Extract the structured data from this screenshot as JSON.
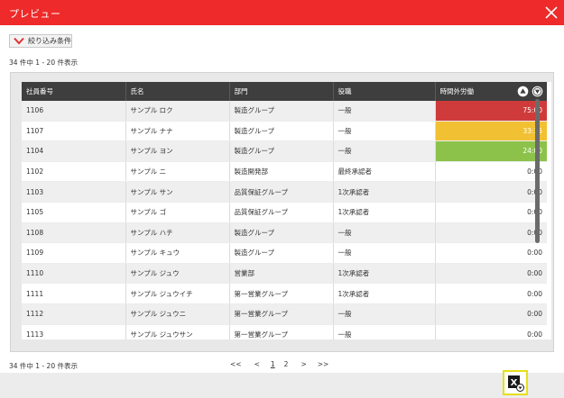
{
  "title": "プレビュー",
  "filter_button": {
    "label": "絞り込み条件"
  },
  "result_count": "34 件中 1 - 20 件表示",
  "result_count_bottom": "34 件中 1 - 20 件表示",
  "columns": [
    "社員番号",
    "氏名",
    "部門",
    "役職",
    "時間外労働"
  ],
  "rows": [
    {
      "id": "1106",
      "name": "サンプル ロク",
      "dept": "製造グループ",
      "role": "一般",
      "overtime": "75:00"
    },
    {
      "id": "1107",
      "name": "サンプル ナナ",
      "dept": "製造グループ",
      "role": "一般",
      "overtime": "33:15"
    },
    {
      "id": "1104",
      "name": "サンプル ヨン",
      "dept": "製造グループ",
      "role": "一般",
      "overtime": "24:00"
    },
    {
      "id": "1102",
      "name": "サンプル ニ",
      "dept": "製造開発部",
      "role": "最終承認者",
      "overtime": "0:00"
    },
    {
      "id": "1103",
      "name": "サンプル サン",
      "dept": "品質保証グループ",
      "role": "1次承認者",
      "overtime": "0:00"
    },
    {
      "id": "1105",
      "name": "サンプル ゴ",
      "dept": "品質保証グループ",
      "role": "1次承認者",
      "overtime": "0:00"
    },
    {
      "id": "1108",
      "name": "サンプル ハチ",
      "dept": "製造グループ",
      "role": "一般",
      "overtime": "0:00"
    },
    {
      "id": "1109",
      "name": "サンプル キュウ",
      "dept": "製造グループ",
      "role": "一般",
      "overtime": "0:00"
    },
    {
      "id": "1110",
      "name": "サンプル ジュウ",
      "dept": "営業部",
      "role": "1次承認者",
      "overtime": "0:00"
    },
    {
      "id": "1111",
      "name": "サンプル ジュウイチ",
      "dept": "第一営業グループ",
      "role": "1次承認者",
      "overtime": "0:00"
    },
    {
      "id": "1112",
      "name": "サンプル ジュウニ",
      "dept": "第一営業グループ",
      "role": "一般",
      "overtime": "0:00"
    },
    {
      "id": "1113",
      "name": "サンプル ジュウサン",
      "dept": "第一営業グループ",
      "role": "一般",
      "overtime": "0:00"
    }
  ],
  "overtime_highlight": [
    "red",
    "amber",
    "green"
  ],
  "colors": {
    "titlebar": "#ee2a2a",
    "header": "#3e3e3e",
    "red": "#cf3b3b",
    "amber": "#f1c133",
    "green": "#8cc24a",
    "excel_border": "#e6df1c"
  },
  "pagination": {
    "first": "<<",
    "prev": "<",
    "pages": [
      "1",
      "2"
    ],
    "current": "1",
    "next": ">",
    "last": ">>"
  },
  "icons": {
    "close": "close-icon",
    "filter": "chevron-down-icon",
    "sort_up": "sort-ascending-icon",
    "sort_down": "sort-descending-icon",
    "export": "excel-export-icon"
  }
}
